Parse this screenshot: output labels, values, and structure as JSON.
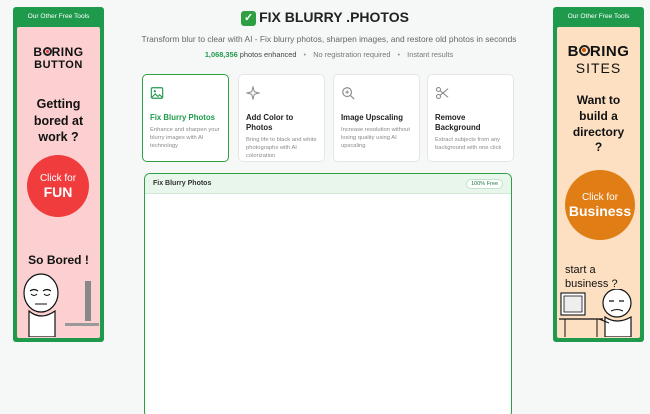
{
  "header": {
    "title": "FIX BLURRY .PHOTOS",
    "subtitle": "Transform blur to clear with AI - Fix blurry photos, sharpen images, and restore old photos in seconds",
    "stats": {
      "count": "1,068,356",
      "count_label": "photos enhanced",
      "no_registration": "No registration required",
      "instant": "Instant results"
    }
  },
  "left_ad": {
    "header": "Our Other Free Tools",
    "brand_top_pre": "B",
    "brand_top_post": "RING",
    "brand_bottom": "BUTTON",
    "headline": "Getting bored at work ?",
    "cta_line1": "Click for",
    "cta_line2": "FUN",
    "footer": "So Bored !",
    "colors": {
      "card": "#fcd0d0",
      "cta": "#f03c3c"
    }
  },
  "right_ad": {
    "header": "Our Other Free Tools",
    "brand_top_pre": "B",
    "brand_top_post": "RING",
    "brand_bottom": "SITES",
    "headline": "Want to build a directory ?",
    "cta_line1": "Click for",
    "cta_line2": "Business",
    "footer": "start a business ?",
    "colors": {
      "card": "#fde0c2",
      "cta": "#e07d14"
    }
  },
  "tools": [
    {
      "title": "Fix Blurry Photos",
      "desc": "Enhance and sharpen your blurry images with AI technology",
      "icon": "image-icon",
      "active": true
    },
    {
      "title": "Add Color to Photos",
      "desc": "Bring life to black and white photographs with AI colorization",
      "icon": "sparkle-icon",
      "active": false
    },
    {
      "title": "Image Upscaling",
      "desc": "Increase resolution without losing quality using AI upscaling",
      "icon": "zoom-icon",
      "active": false
    },
    {
      "title": "Remove Background",
      "desc": "Extract subjects from any background with one click",
      "icon": "scissors-icon",
      "active": false
    }
  ],
  "panel": {
    "title": "Fix Blurry Photos",
    "badge": "100% Free"
  },
  "colors": {
    "accent": "#2ea043",
    "brand_green": "#1f9a4c"
  }
}
